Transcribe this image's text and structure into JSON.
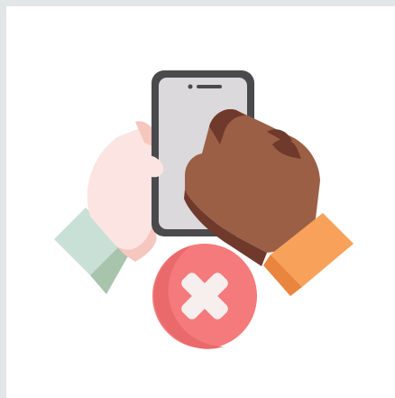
{
  "illustration": {
    "name": "no-phone-sharing-icon",
    "colors": {
      "frame": "#e3e6e6",
      "panel": "#ffffff",
      "phone_body": "#4a4a4c",
      "phone_screen": "#dcd9dc",
      "light_hand": "#fbe4e1",
      "light_hand_shadow": "#f6c7bf",
      "light_sleeve": "#c8e0d5",
      "light_sleeve_shadow": "#a9c4ac",
      "dark_hand": "#9b5f46",
      "dark_hand_shadow": "#6f3a2c",
      "dark_sleeve": "#f7a15a",
      "dark_sleeve_shadow": "#e9853f",
      "x_circle": "#f47a7c",
      "x_circle_shadow": "#ea6a6c",
      "x_mark": "#f7eeee"
    }
  }
}
